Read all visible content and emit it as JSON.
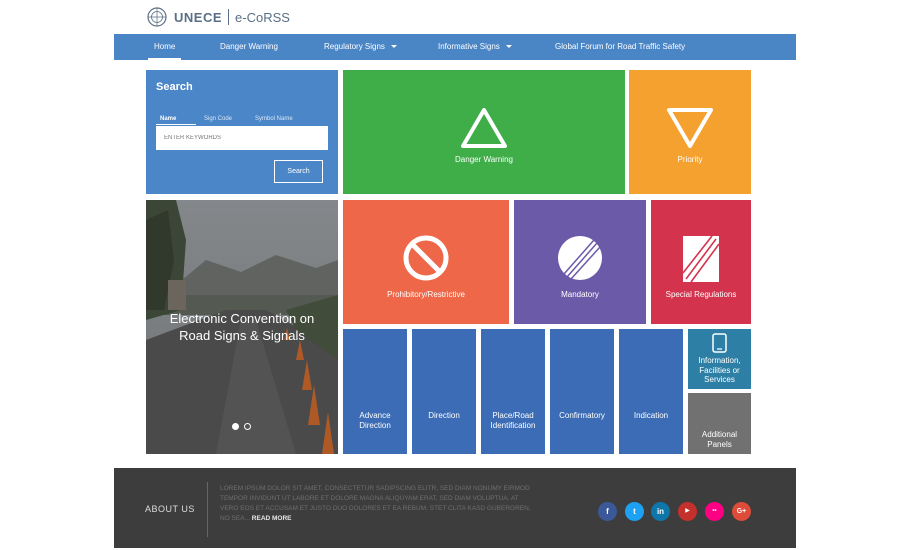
{
  "header": {
    "org": "UNECE",
    "app": "e-CoRSS"
  },
  "nav": {
    "items": [
      {
        "label": "Home",
        "active": true,
        "dropdown": false
      },
      {
        "label": "Danger Warning",
        "active": false,
        "dropdown": false
      },
      {
        "label": "Regulatory Signs",
        "active": false,
        "dropdown": true
      },
      {
        "label": "Informative Signs",
        "active": false,
        "dropdown": true
      },
      {
        "label": "Global Forum for Road Traffic Safety",
        "active": false,
        "dropdown": false
      }
    ]
  },
  "search": {
    "title": "Search",
    "tabs": [
      "Name",
      "Sign Code",
      "Symbol Name"
    ],
    "active_tab": "Name",
    "placeholder": "ENTER KEYWORDS",
    "value": "",
    "button": "Search"
  },
  "hero": {
    "title_line1": "Electronic Convention on",
    "title_line2": "Road Signs & Signals",
    "slides": 2,
    "active_slide": 1
  },
  "tiles": {
    "danger_warning": {
      "label": "Danger Warning",
      "color": "#3fae49",
      "icon": "triangle-icon"
    },
    "priority": {
      "label": "Priority",
      "color": "#f4a12f",
      "icon": "inverted-triangle-icon"
    },
    "prohibitory": {
      "label": "Prohibitory/Restrictive",
      "color": "#ee6748",
      "icon": "no-entry-circle-icon"
    },
    "mandatory": {
      "label": "Mandatory",
      "color": "#6b5aa8",
      "icon": "striped-circle-icon"
    },
    "special_regulations": {
      "label": "Special Regulations",
      "color": "#d3334d",
      "icon": "striped-square-icon"
    },
    "advance_direction": {
      "label_line1": "Advance",
      "label_line2": "Direction",
      "color": "#3b6cb5"
    },
    "direction": {
      "label": "Direction",
      "color": "#3b6cb5"
    },
    "place_road": {
      "label_line1": "Place/Road",
      "label_line2": "Identification",
      "color": "#3b6cb5"
    },
    "confirmatory": {
      "label": "Confirmatory",
      "color": "#3b6cb5"
    },
    "indication": {
      "label": "Indication",
      "color": "#3b6cb5"
    },
    "information": {
      "label_line1": "Information,",
      "label_line2": "Facilities or",
      "label_line3": "Services",
      "color": "#2d7fa6",
      "icon": "tablet-icon"
    },
    "additional_panels": {
      "label_line1": "Additional",
      "label_line2": "Panels",
      "color": "#717171"
    }
  },
  "footer": {
    "about": "ABOUT US",
    "text": "Lorem ipsum dolor sit amet, consectetur sadipscing elitr, sed diam nonumy eirmod tempor invidunt ut labore et dolore magna aliquyam erat, sed diam voluptua. At vero eos et accusam et justo duo dolores et ea rebum. Stet clita kasd gubergren, no sea...",
    "read_more": "READ MORE",
    "social": [
      {
        "name": "facebook",
        "glyph": "f",
        "color": "#3b5998"
      },
      {
        "name": "twitter",
        "glyph": "t",
        "color": "#1da1f2"
      },
      {
        "name": "linkedin",
        "glyph": "in",
        "color": "#0e76a8"
      },
      {
        "name": "youtube",
        "glyph": "▶",
        "color": "#c4302b"
      },
      {
        "name": "flickr",
        "glyph": "••",
        "color": "#ff0084"
      },
      {
        "name": "google-plus",
        "glyph": "G+",
        "color": "#dd4b39"
      }
    ]
  }
}
